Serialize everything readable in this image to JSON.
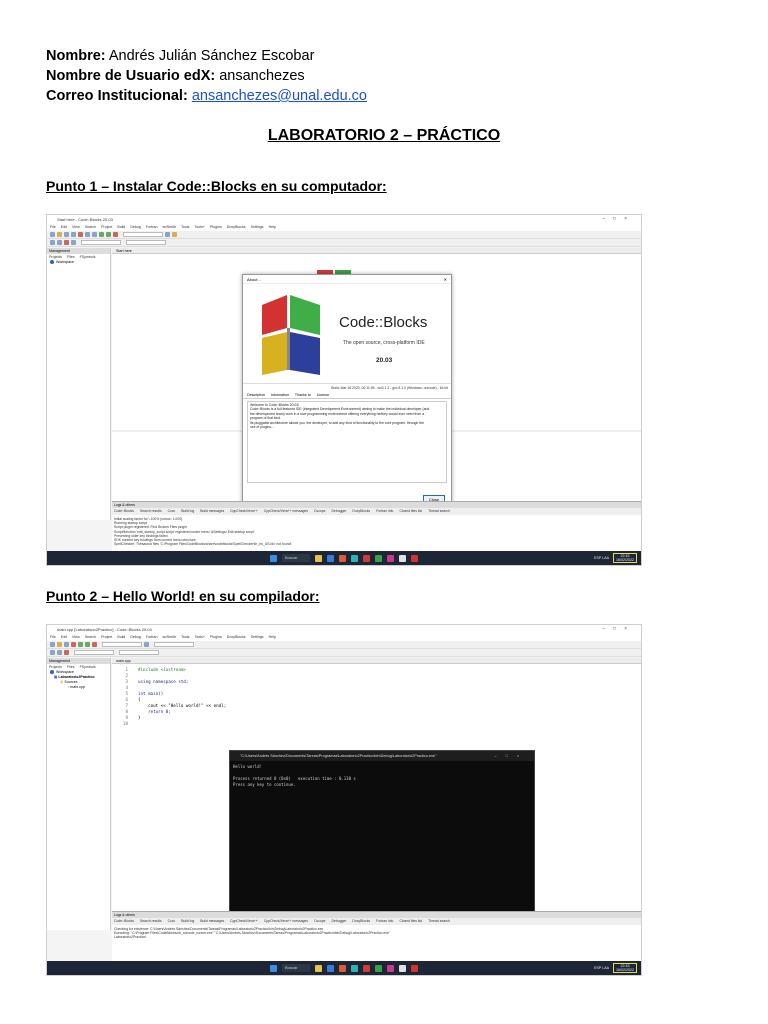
{
  "header": {
    "name_label": "Nombre:",
    "name_value": "Andrés Julián Sánchez Escobar",
    "user_label": "Nombre de Usuario edX:",
    "user_value": "ansanchezes",
    "email_label": "Correo Institucional:",
    "email_value": "ansanchezes@unal.edu.co"
  },
  "title": "LABORATORIO 2 – PRÁCTICO",
  "section1": {
    "heading": "Punto 1 – Instalar Code::Blocks en su computador:",
    "window_title": "Start here - Code::Blocks 20.03",
    "menu": [
      "File",
      "Edit",
      "View",
      "Search",
      "Project",
      "Build",
      "Debug",
      "Fortran",
      "wxSmith",
      "Tools",
      "Tools+",
      "Plugins",
      "DoxyBlocks",
      "Settings",
      "Help"
    ],
    "mgmt_header": "Management",
    "mgmt_tabs": [
      "Projects",
      "Files",
      "FSymbols"
    ],
    "workspace": "Workspace",
    "editor_tab": "Start here",
    "about": {
      "title": "About...",
      "brand": "Code::Blocks",
      "tagline": "The open source, cross-platform IDE",
      "version": "20.03",
      "build": "Build: Mar 16 2020, 00:11:55 - wx3.1.3 - gcc 8.1.0 (Windows, unicode) - 64 bit",
      "tabs": [
        "Description",
        "Information",
        "Thanks to",
        "License"
      ],
      "desc_lines": [
        "Welcome to Code::Blocks 20.03!",
        "Code::Blocks is a full-featured IDE (Integrated Development Environment) aiming to make the individual developer (and",
        "the development team) work in a nice programming environment offering everything he/they would ever need from a",
        "program of that kind.",
        "Its pluggable architecture allows you, the developer, to add any kind of functionality to the core program, through the",
        "use of plugins..."
      ],
      "close": "Close"
    },
    "logs_header": "Logs & others",
    "log_tabs": [
      "Code::Blocks",
      "Search results",
      "Cccc",
      "Build log",
      "Build messages",
      "CppCheck/Vera++",
      "CppCheck/Vera++ messages",
      "Cscope",
      "Debugger",
      "DoxyBlocks",
      "Fortran info",
      "Closed files list",
      "Thread search"
    ],
    "log_lines": [
      "Initial scaling factor for \\ 100% (cursor: 1.000)",
      "Running startup script",
      "Script plugin registered: Find Broken Files plugin",
      "Script/function 'edit_startup_script.script' registered under menu '&Settings/-Edit startup script'",
      "Preserving older key bindings failed",
      "SDK content key bindings from current menu structure",
      "SpellChecker: Thesaurus files 'C:\\Program Files\\CodeBlocks\\share\\codeblocks\\SpellChecker\\th_en_US.idx' not found!"
    ],
    "search_label": "Buscar"
  },
  "section2": {
    "heading": "Punto 2 – Hello World! en su compilador:",
    "window_title": "main.cpp [Laboratorio2Practico] - Code::Blocks 20.03",
    "workspace": "Workspace",
    "project": "Laboratorio2Practico",
    "sources": "Sources",
    "file": "main.cpp",
    "editor_tab": "main.cpp",
    "code": [
      {
        "n": "1",
        "t": "#include <iostream>"
      },
      {
        "n": "2",
        "t": ""
      },
      {
        "n": "3",
        "t": "using namespace std;"
      },
      {
        "n": "4",
        "t": ""
      },
      {
        "n": "5",
        "t": "int main()"
      },
      {
        "n": "6",
        "t": "{"
      },
      {
        "n": "7",
        "t": "    cout << \"Hello world!\" << endl;"
      },
      {
        "n": "8",
        "t": "    return 0;"
      },
      {
        "n": "9",
        "t": "}"
      },
      {
        "n": "10",
        "t": ""
      }
    ],
    "terminal": {
      "title": "\"C:\\Users\\Andrés Sánchez\\Documents\\Tareas\\Programas\\Laboratorio2Practico\\bin\\Debug\\Laboratorio2Practico.exe\"",
      "lines": [
        "Hello world!",
        "",
        "Process returned 0 (0x0)   execution time : 0.130 s",
        "Press any key to continue."
      ]
    },
    "logs_header": "Logs & others",
    "log_tabs": [
      "Code::Blocks",
      "Search results",
      "Cccc",
      "Build log",
      "Build messages",
      "CppCheck/Vera++",
      "CppCheck/Vera++ messages",
      "Cscope",
      "Debugger",
      "DoxyBlocks",
      "Fortran info",
      "Closed files list",
      "Thread search"
    ],
    "log_lines": [
      "Checking for existence: C:\\Users\\Andrés Sánchez\\Documents\\Tareas\\Programas\\Laboratorio2Practico\\bin\\Debug\\Laboratorio2Practico.exe",
      "Executing: \"C:\\Program Files\\CodeBlocks/cb_console_runner.exe\" \"C:\\Users\\Andrés Sánchez\\Documents\\Tareas\\Programas\\Laboratorio2Practico\\bin\\Debug\\Laboratorio2Practico.exe\"",
      "Laboratorio2Practico\\"
    ],
    "search_label": "Buscar"
  },
  "tray": {
    "lang": "ESP\nLAA",
    "time": "22:15",
    "date": "16/02/2022"
  }
}
